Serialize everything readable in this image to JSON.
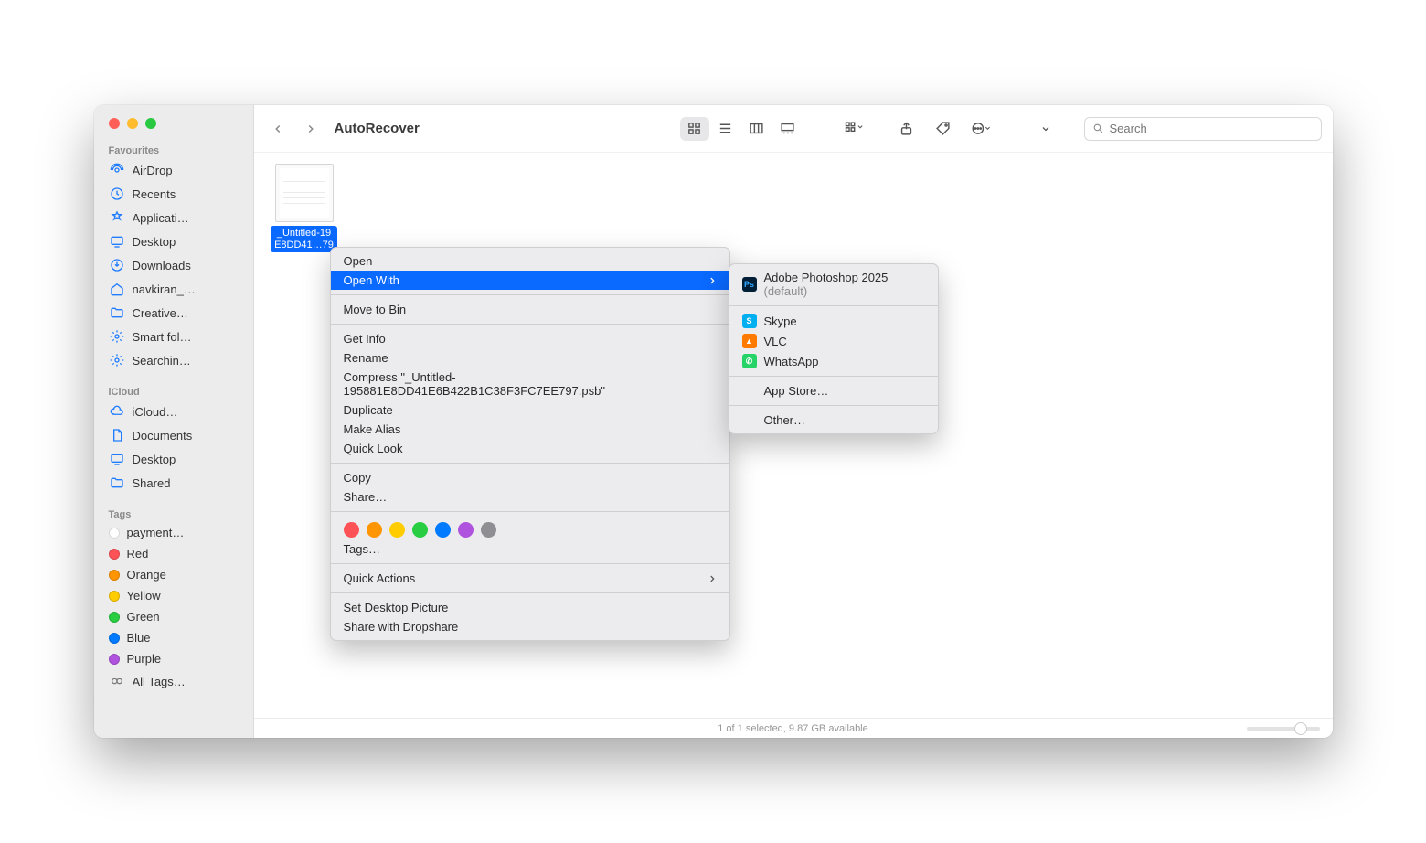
{
  "window_title": "AutoRecover",
  "search": {
    "placeholder": "Search"
  },
  "sidebar": {
    "groups": [
      {
        "label": "Favourites",
        "items": [
          {
            "label": "AirDrop",
            "icon": "airdrop-icon"
          },
          {
            "label": "Recents",
            "icon": "clock-icon"
          },
          {
            "label": "Applicati…",
            "icon": "apps-icon"
          },
          {
            "label": "Desktop",
            "icon": "desktop-icon"
          },
          {
            "label": "Downloads",
            "icon": "download-icon"
          },
          {
            "label": "navkiran_…",
            "icon": "home-icon"
          },
          {
            "label": "Creative…",
            "icon": "folder-icon"
          },
          {
            "label": "Smart fol…",
            "icon": "gear-icon"
          },
          {
            "label": "Searchin…",
            "icon": "gear-icon"
          }
        ]
      },
      {
        "label": "iCloud",
        "items": [
          {
            "label": "iCloud…",
            "icon": "cloud-icon"
          },
          {
            "label": "Documents",
            "icon": "doc-icon"
          },
          {
            "label": "Desktop",
            "icon": "desktop-icon"
          },
          {
            "label": "Shared",
            "icon": "shared-icon"
          }
        ]
      },
      {
        "label": "Tags",
        "items": [
          {
            "label": "payment…",
            "color": "#ffffff"
          },
          {
            "label": "Red",
            "color": "#ff5257"
          },
          {
            "label": "Orange",
            "color": "#ff9500"
          },
          {
            "label": "Yellow",
            "color": "#ffcc00"
          },
          {
            "label": "Green",
            "color": "#28cd41"
          },
          {
            "label": "Blue",
            "color": "#007aff"
          },
          {
            "label": "Purple",
            "color": "#af52de"
          },
          {
            "label": "All Tags…",
            "icon": "alltags-icon"
          }
        ]
      }
    ]
  },
  "file": {
    "name_line1": "_Untitled-19",
    "name_line2": "E8DD41…79"
  },
  "statusbar": "1 of 1 selected, 9.87 GB available",
  "context_menu": {
    "open": "Open",
    "open_with": "Open With",
    "move_to_bin": "Move to Bin",
    "get_info": "Get Info",
    "rename": "Rename",
    "compress": "Compress \"_Untitled-195881E8DD41E6B422B1C38F3FC7EE797.psb\"",
    "duplicate": "Duplicate",
    "make_alias": "Make Alias",
    "quick_look": "Quick Look",
    "copy": "Copy",
    "share": "Share…",
    "tags": "Tags…",
    "quick_actions": "Quick Actions",
    "set_desktop": "Set Desktop Picture",
    "share_dropshare": "Share with Dropshare",
    "tag_colors": [
      "#ff5257",
      "#ff9500",
      "#ffcc00",
      "#28cd41",
      "#007aff",
      "#af52de",
      "#8e8e93"
    ]
  },
  "submenu": {
    "default_app": "Adobe Photoshop 2025",
    "default_suffix": " (default)",
    "apps": [
      {
        "name": "Skype",
        "color": "#00aff0"
      },
      {
        "name": "VLC",
        "color": "#ff7a00"
      },
      {
        "name": "WhatsApp",
        "color": "#25d366"
      }
    ],
    "app_store": "App Store…",
    "other": "Other…"
  }
}
